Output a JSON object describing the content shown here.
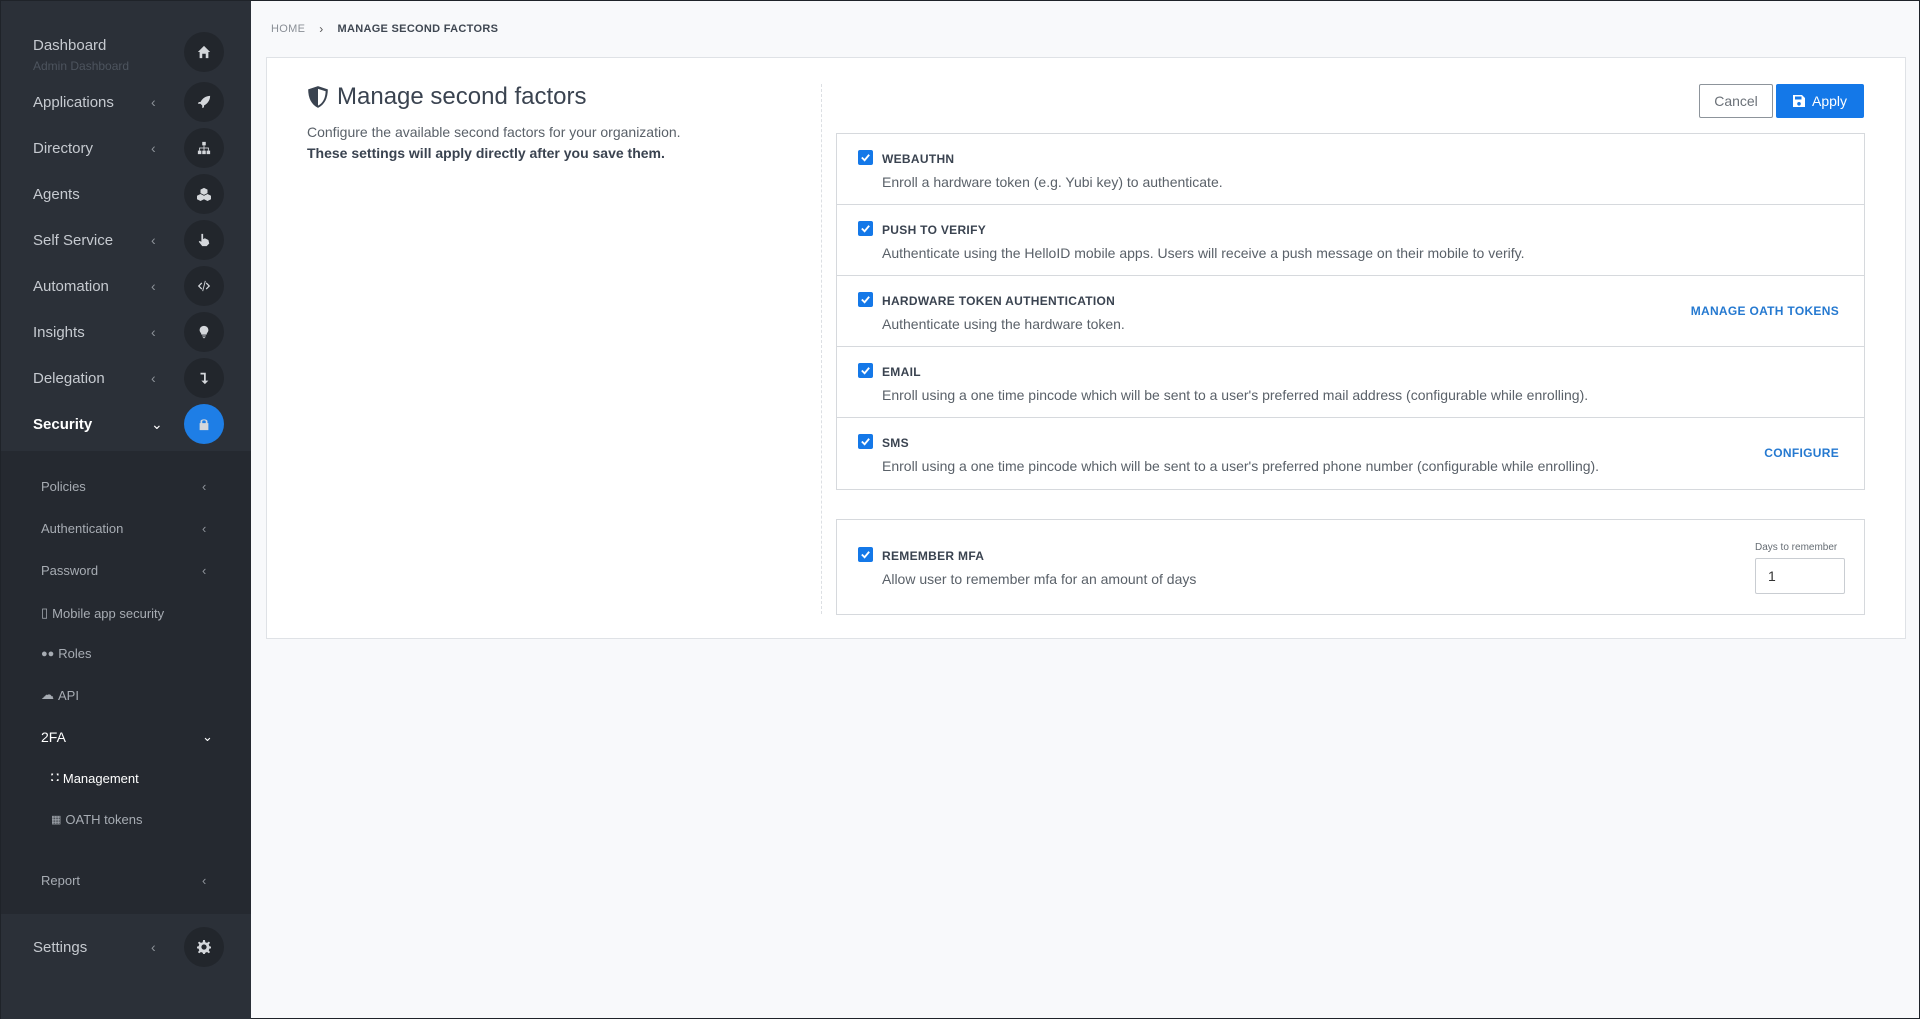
{
  "sidebar": {
    "items": [
      {
        "label": "Dashboard",
        "sub": "Admin Dashboard",
        "icon": "home-icon"
      },
      {
        "label": "Applications",
        "icon": "rocket-icon"
      },
      {
        "label": "Directory",
        "icon": "sitemap-icon"
      },
      {
        "label": "Agents",
        "icon": "cubes-icon"
      },
      {
        "label": "Self Service",
        "icon": "hand-pointer-icon"
      },
      {
        "label": "Automation",
        "icon": "code-icon"
      },
      {
        "label": "Insights",
        "icon": "lightbulb-icon"
      },
      {
        "label": "Delegation",
        "icon": "level-down-icon"
      },
      {
        "label": "Security",
        "icon": "lock-icon"
      }
    ],
    "security_sub": {
      "policies": "Policies",
      "authentication": "Authentication",
      "password": "Password",
      "mobile_app_security": "Mobile app security",
      "roles": "Roles",
      "api": "API",
      "twofa": "2FA",
      "management": "Management",
      "oath_tokens": "OATH tokens",
      "report": "Report"
    },
    "settings": "Settings"
  },
  "breadcrumb": {
    "home": "HOME",
    "current": "MANAGE SECOND FACTORS"
  },
  "page": {
    "title": "Manage second factors",
    "description": "Configure the available second factors for your organization.",
    "note": "These settings will apply directly after you save them.",
    "cancel_label": "Cancel",
    "apply_label": "Apply"
  },
  "factors": [
    {
      "title": "WEBAUTHN",
      "desc": "Enroll a hardware token (e.g. Yubi key) to authenticate.",
      "checked": true,
      "link": ""
    },
    {
      "title": "PUSH TO VERIFY",
      "desc": "Authenticate using the HelloID mobile apps. Users will receive a push message on their mobile to verify.",
      "checked": true,
      "link": ""
    },
    {
      "title": "HARDWARE TOKEN AUTHENTICATION",
      "desc": "Authenticate using the hardware token.",
      "checked": true,
      "link": "MANAGE OATH TOKENS"
    },
    {
      "title": "EMAIL",
      "desc": "Enroll using a one time pincode which will be sent to a user's preferred mail address (configurable while enrolling).",
      "checked": true,
      "link": ""
    },
    {
      "title": "SMS",
      "desc": "Enroll using a one time pincode which will be sent to a user's preferred phone number (configurable while enrolling).",
      "checked": true,
      "link": "CONFIGURE"
    }
  ],
  "remember": {
    "title": "REMEMBER MFA",
    "desc": "Allow user to remember mfa for an amount of days",
    "days_label": "Days to remember",
    "days_value": "1",
    "checked": true
  },
  "colors": {
    "sidebar_bg": "#2b3038",
    "accent": "#1478e8",
    "link": "#2579d0"
  }
}
